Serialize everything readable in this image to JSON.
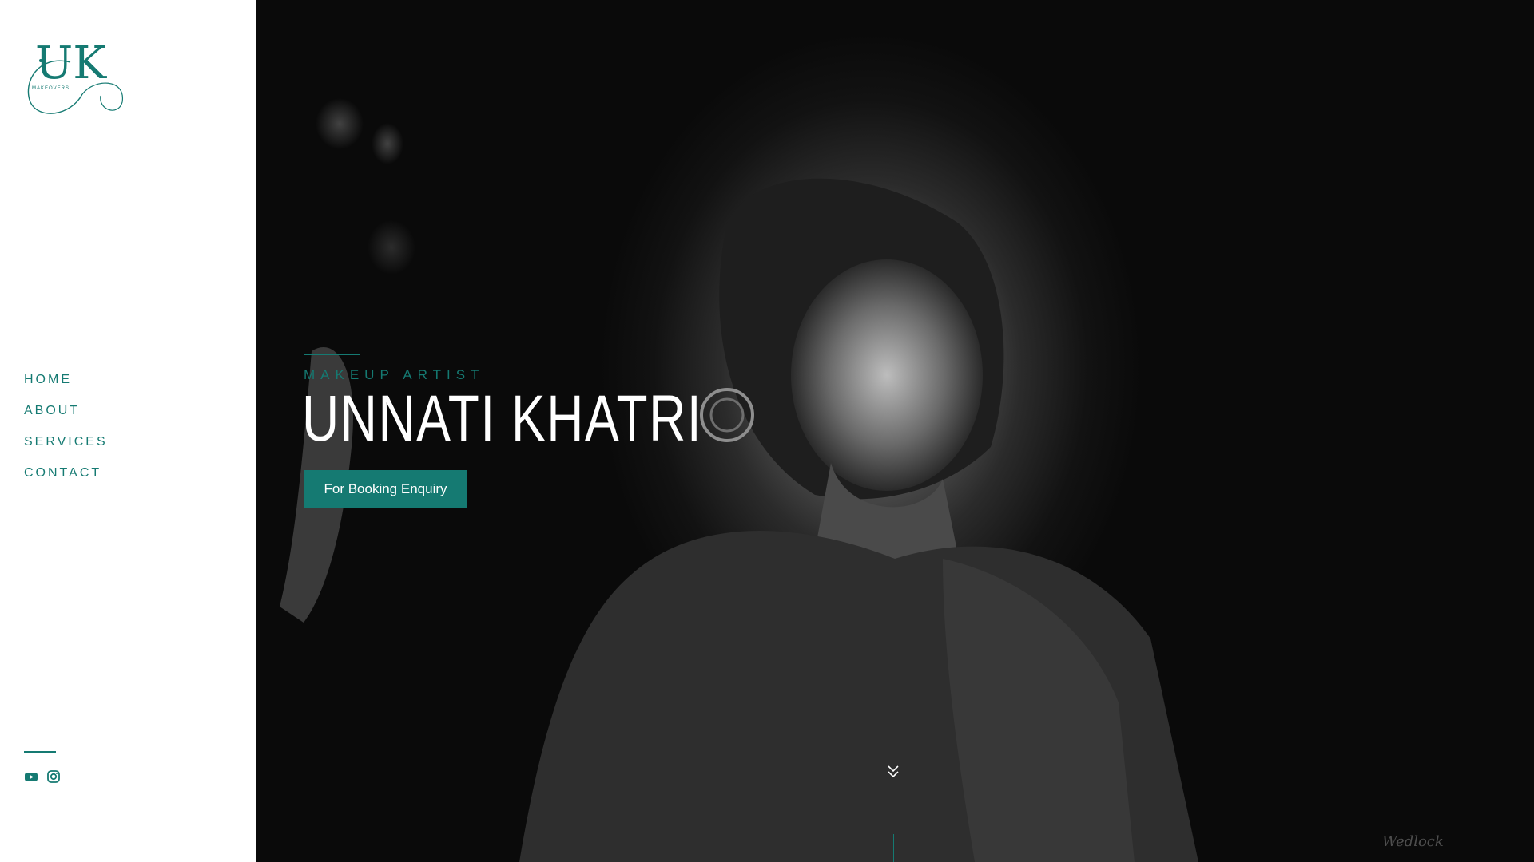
{
  "logo": {
    "letters": "UK",
    "subtitle": "MAKEOVERS"
  },
  "nav": {
    "items": [
      {
        "label": "HOME"
      },
      {
        "label": "ABOUT"
      },
      {
        "label": "SERVICES"
      },
      {
        "label": "CONTACT"
      }
    ]
  },
  "social": {
    "icons": [
      "youtube-icon",
      "instagram-icon"
    ]
  },
  "hero": {
    "subtitle": "MAKEUP ARTIST",
    "title": "UNNATI KHATRI",
    "cta_label": "For Booking Enquiry",
    "scroll_icon": "double-chevron-down-icon",
    "watermark": "Wedlock"
  },
  "colors": {
    "accent": "#157a72",
    "sidebar_bg": "#ffffff",
    "hero_text": "#ffffff"
  }
}
